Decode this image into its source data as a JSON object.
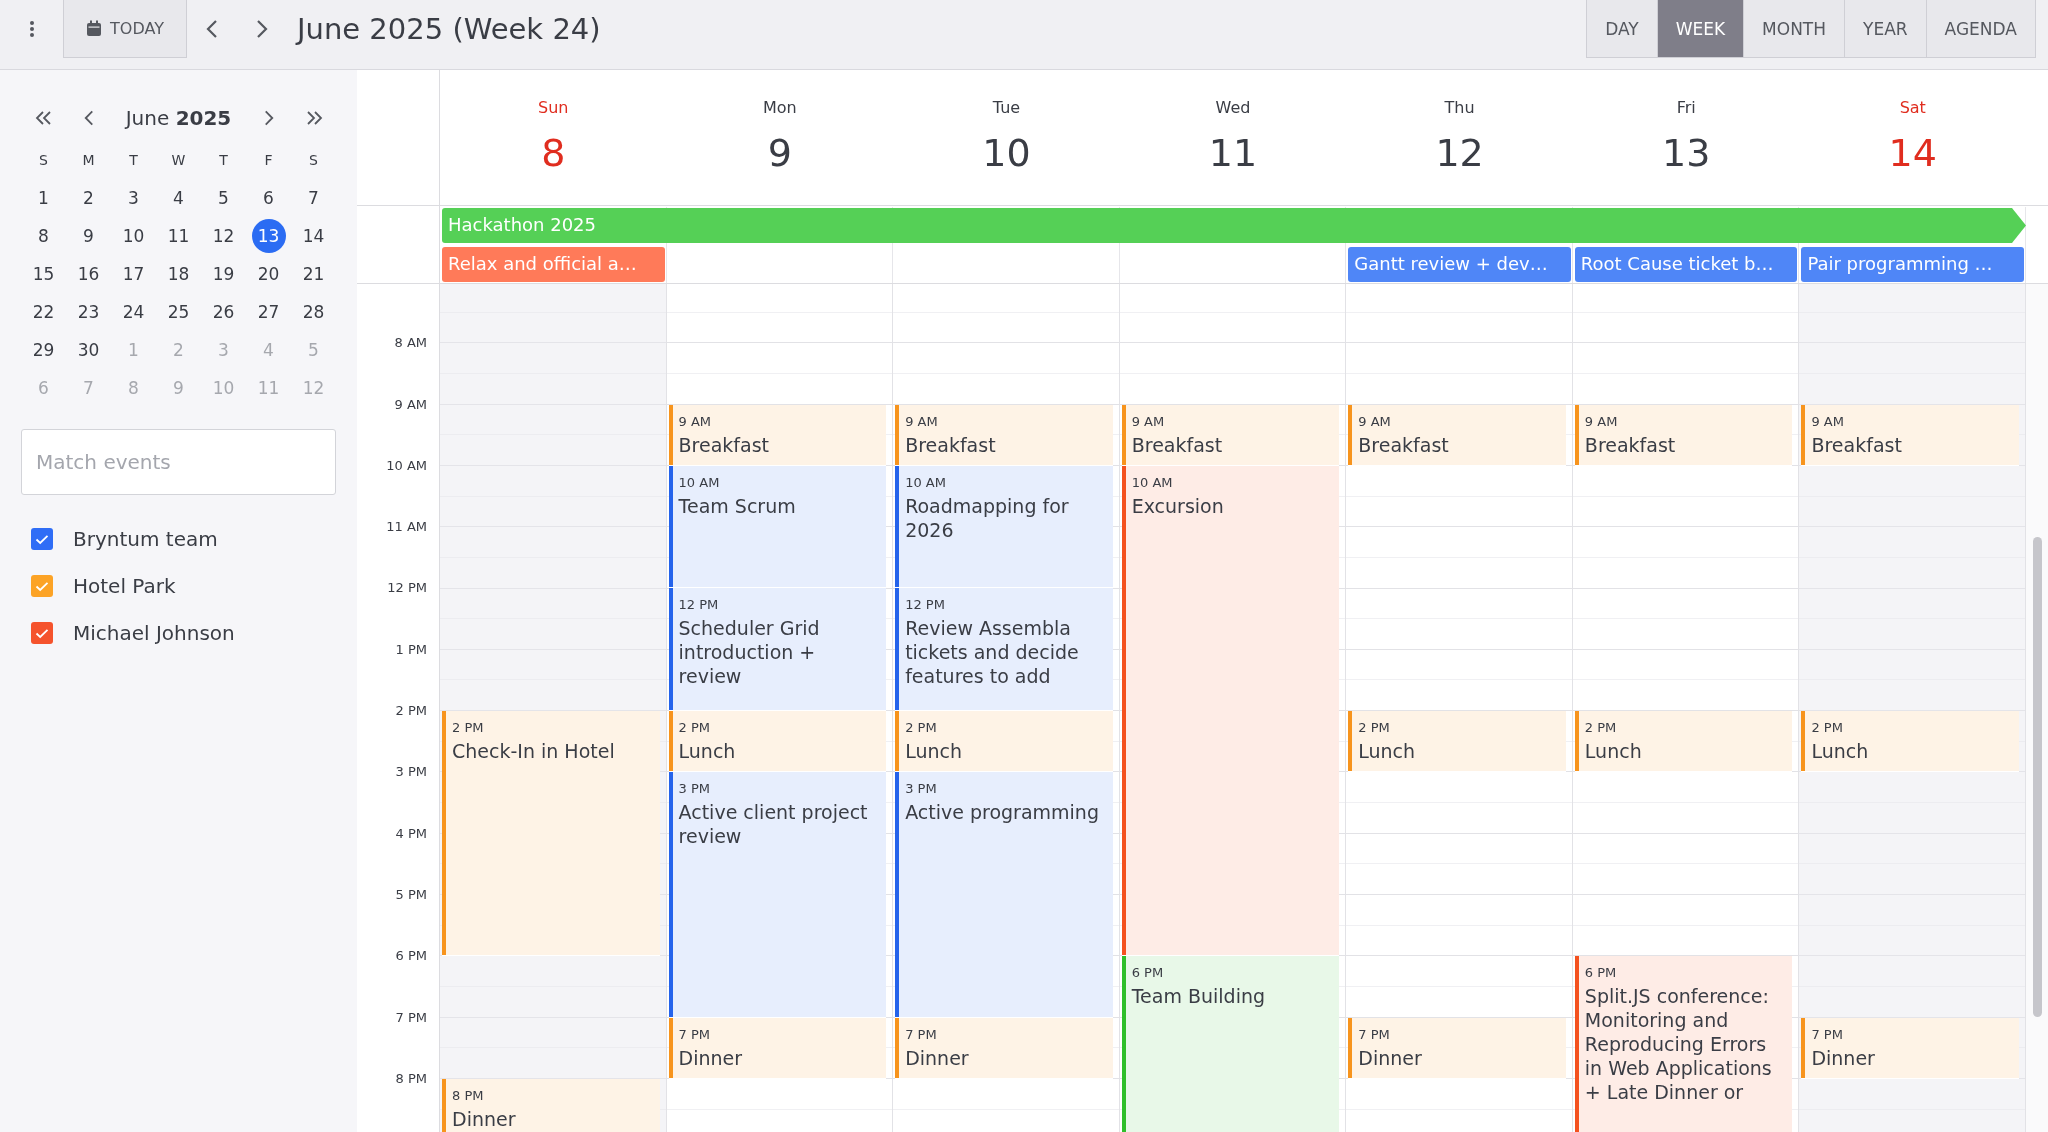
{
  "toolbar": {
    "today": "TODAY",
    "title": "June 2025 (Week 24)",
    "views": [
      {
        "label": "DAY",
        "selected": false
      },
      {
        "label": "WEEK",
        "selected": true
      },
      {
        "label": "MONTH",
        "selected": false
      },
      {
        "label": "YEAR",
        "selected": false
      },
      {
        "label": "AGENDA",
        "selected": false
      }
    ]
  },
  "mini_calendar": {
    "title": "June **2025**",
    "weekdays": [
      "S",
      "M",
      "T",
      "W",
      "T",
      "F",
      "S"
    ],
    "days": [
      {
        "day": "1",
        "other_month": false,
        "selected": false
      },
      {
        "day": "2",
        "other_month": false,
        "selected": false
      },
      {
        "day": "3",
        "other_month": false,
        "selected": false
      },
      {
        "day": "4",
        "other_month": false,
        "selected": false
      },
      {
        "day": "5",
        "other_month": false,
        "selected": false
      },
      {
        "day": "6",
        "other_month": false,
        "selected": false
      },
      {
        "day": "7",
        "other_month": false,
        "selected": false
      },
      {
        "day": "8",
        "other_month": false,
        "selected": false
      },
      {
        "day": "9",
        "other_month": false,
        "selected": false
      },
      {
        "day": "10",
        "other_month": false,
        "selected": false
      },
      {
        "day": "11",
        "other_month": false,
        "selected": false
      },
      {
        "day": "12",
        "other_month": false,
        "selected": false
      },
      {
        "day": "13",
        "other_month": false,
        "selected": true
      },
      {
        "day": "14",
        "other_month": false,
        "selected": false
      },
      {
        "day": "15",
        "other_month": false,
        "selected": false
      },
      {
        "day": "16",
        "other_month": false,
        "selected": false
      },
      {
        "day": "17",
        "other_month": false,
        "selected": false
      },
      {
        "day": "18",
        "other_month": false,
        "selected": false
      },
      {
        "day": "19",
        "other_month": false,
        "selected": false
      },
      {
        "day": "20",
        "other_month": false,
        "selected": false
      },
      {
        "day": "21",
        "other_month": false,
        "selected": false
      },
      {
        "day": "22",
        "other_month": false,
        "selected": false
      },
      {
        "day": "23",
        "other_month": false,
        "selected": false
      },
      {
        "day": "24",
        "other_month": false,
        "selected": false
      },
      {
        "day": "25",
        "other_month": false,
        "selected": false
      },
      {
        "day": "26",
        "other_month": false,
        "selected": false
      },
      {
        "day": "27",
        "other_month": false,
        "selected": false
      },
      {
        "day": "28",
        "other_month": false,
        "selected": false
      },
      {
        "day": "29",
        "other_month": false,
        "selected": false
      },
      {
        "day": "30",
        "other_month": false,
        "selected": false
      },
      {
        "day": "1",
        "other_month": true,
        "selected": false
      },
      {
        "day": "2",
        "other_month": true,
        "selected": false
      },
      {
        "day": "3",
        "other_month": true,
        "selected": false
      },
      {
        "day": "4",
        "other_month": true,
        "selected": false
      },
      {
        "day": "5",
        "other_month": true,
        "selected": false
      },
      {
        "day": "6",
        "other_month": true,
        "selected": false
      },
      {
        "day": "7",
        "other_month": true,
        "selected": false
      },
      {
        "day": "8",
        "other_month": true,
        "selected": false
      },
      {
        "day": "9",
        "other_month": true,
        "selected": false
      },
      {
        "day": "10",
        "other_month": true,
        "selected": false
      },
      {
        "day": "11",
        "other_month": true,
        "selected": false
      },
      {
        "day": "12",
        "other_month": true,
        "selected": false
      }
    ]
  },
  "filter": {
    "placeholder": "Match events"
  },
  "resources": [
    {
      "name": "Bryntum team",
      "color": "#2f6df6",
      "checked": true
    },
    {
      "name": "Hotel Park",
      "color": "#fca326",
      "checked": true
    },
    {
      "name": "Michael Johnson",
      "color": "#f5532d",
      "checked": true
    }
  ],
  "week_banner": {
    "title": "Hackathon 2025",
    "color": "#55d056",
    "continues": true
  },
  "hours": [
    "8 AM",
    "9 AM",
    "10 AM",
    "11 AM",
    "12 PM",
    "1 PM",
    "2 PM",
    "3 PM",
    "4 PM",
    "5 PM",
    "6 PM",
    "7 PM",
    "8 PM"
  ],
  "days": [
    {
      "name": "Sun",
      "date": "8",
      "weekend": true,
      "all_day": [
        {
          "title": "Relax and official a…",
          "color": "#ff7a59"
        }
      ],
      "blocks": [
        {
          "kind": "freeseven"
        },
        {
          "kind": "fourhours",
          "time": "2 PM",
          "title": "Check-In in Hotel",
          "color": "#f7941d"
        },
        {
          "kind": "freetwo"
        },
        {
          "kind": "onehour",
          "time": "8 PM",
          "title": "Dinner",
          "color": "#f7941d"
        }
      ]
    },
    {
      "name": "Mon",
      "date": "9",
      "weekend": false,
      "blocks": [
        {
          "kind": "freetwo"
        },
        {
          "kind": "onehour",
          "time": "9 AM",
          "title": "Breakfast",
          "color": "#f7941d"
        },
        {
          "kind": "twohours",
          "time": "10 AM",
          "title": "Team Scrum",
          "color": "#2563eb"
        },
        {
          "kind": "twohours",
          "time": "12 PM",
          "title": "Scheduler Grid introduction + review",
          "color": "#2563eb"
        },
        {
          "kind": "onehour",
          "time": "2 PM",
          "title": "Lunch",
          "color": "#f7941d"
        },
        {
          "kind": "fourhours",
          "time": "3 PM",
          "title": "Active client project review",
          "color": "#2563eb"
        },
        {
          "kind": "onehour",
          "time": "7 PM",
          "title": "Dinner",
          "color": "#f7941d"
        }
      ]
    },
    {
      "name": "Tue",
      "date": "10",
      "weekend": false,
      "blocks": [
        {
          "kind": "freetwo"
        },
        {
          "kind": "onehour",
          "time": "9 AM",
          "title": "Breakfast",
          "color": "#f7941d"
        },
        {
          "kind": "twohours",
          "time": "10 AM",
          "title": "Roadmapping for 2026",
          "color": "#2563eb"
        },
        {
          "kind": "twohours",
          "time": "12 PM",
          "title": "Review Assembla tickets and decide features to add",
          "color": "#2563eb"
        },
        {
          "kind": "onehour",
          "time": "2 PM",
          "title": "Lunch",
          "color": "#f7941d"
        },
        {
          "kind": "fourhours",
          "time": "3 PM",
          "title": "Active programming",
          "color": "#2563eb"
        },
        {
          "kind": "onehour",
          "time": "7 PM",
          "title": "Dinner",
          "color": "#f7941d"
        }
      ]
    },
    {
      "name": "Wed",
      "date": "11",
      "weekend": false,
      "blocks": [
        {
          "kind": "freetwo"
        },
        {
          "kind": "onehour",
          "time": "9 AM",
          "title": "Breakfast",
          "color": "#f7941d"
        },
        {
          "kind": "eighthours",
          "time": "10 AM",
          "title": "Excursion",
          "color": "#f4511e"
        },
        {
          "kind": "threehours",
          "time": "6 PM",
          "title": "Team Building",
          "color": "#2fbf2a"
        }
      ]
    },
    {
      "name": "Thu",
      "date": "12",
      "weekend": false,
      "all_day": [
        {
          "title": "Gantt review + dev…",
          "color": "#4f86f7"
        }
      ],
      "blocks": [
        {
          "kind": "freetwo"
        },
        {
          "kind": "onehour",
          "time": "9 AM",
          "title": "Breakfast",
          "color": "#f7941d"
        },
        {
          "kind": "freefour"
        },
        {
          "kind": "onehour",
          "time": "2 PM",
          "title": "Lunch",
          "color": "#f7941d"
        },
        {
          "kind": "freefour"
        },
        {
          "kind": "onehour",
          "time": "7 PM",
          "title": "Dinner",
          "color": "#f7941d"
        }
      ]
    },
    {
      "name": "Fri",
      "date": "13",
      "weekend": false,
      "all_day": [
        {
          "title": "Root Cause ticket b…",
          "color": "#4f86f7"
        }
      ],
      "blocks": [
        {
          "kind": "freetwo"
        },
        {
          "kind": "onehour",
          "time": "9 AM",
          "title": "Breakfast",
          "color": "#f7941d"
        },
        {
          "kind": "freefour"
        },
        {
          "kind": "onehour",
          "time": "2 PM",
          "title": "Lunch",
          "color": "#f7941d"
        },
        {
          "kind": "freethree"
        },
        {
          "kind": "threehours",
          "time": "6 PM",
          "title": "Split.JS conference: Monitoring and Reproducing Errors in Web Applications + Late Dinner or",
          "color": "#f4511e"
        }
      ]
    },
    {
      "name": "Sat",
      "date": "14",
      "weekend": true,
      "all_day": [
        {
          "title": "Pair programming …",
          "color": "#4f86f7"
        }
      ],
      "blocks": [
        {
          "kind": "freetwo"
        },
        {
          "kind": "onehour",
          "time": "9 AM",
          "title": "Breakfast",
          "color": "#f7941d"
        },
        {
          "kind": "freefour"
        },
        {
          "kind": "onehour",
          "time": "2 PM",
          "title": "Lunch",
          "color": "#f7941d"
        },
        {
          "kind": "freefour"
        },
        {
          "kind": "onehour",
          "time": "7 PM",
          "title": "Dinner",
          "color": "#f7941d"
        }
      ]
    }
  ]
}
